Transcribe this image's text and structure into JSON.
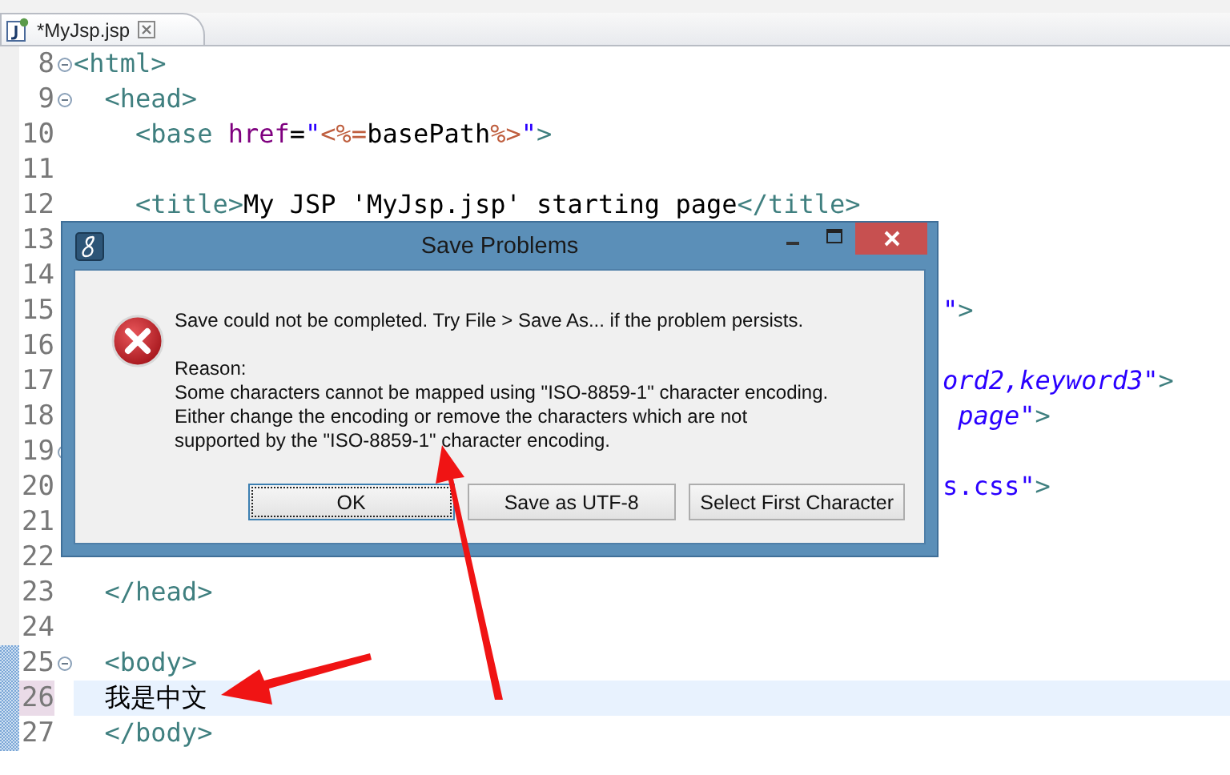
{
  "tabs": [
    {
      "label": "*MyJsp.jsp",
      "selected": true
    }
  ],
  "editor": {
    "lines": [
      {
        "number": "8",
        "fold": true,
        "changed": false,
        "current": false,
        "segments": [
          {
            "kind": "tag",
            "text": "<html>"
          }
        ]
      },
      {
        "number": "9",
        "fold": true,
        "changed": false,
        "current": false,
        "segments": [
          {
            "kind": "tag",
            "text": "  <head>"
          }
        ]
      },
      {
        "number": "10",
        "fold": false,
        "changed": false,
        "current": false,
        "segments": [
          {
            "kind": "tag",
            "text": "    <base"
          },
          {
            "kind": "attr",
            "text": " href"
          },
          {
            "kind": "text",
            "text": "="
          },
          {
            "kind": "string",
            "text": "\""
          },
          {
            "kind": "jsp",
            "text": "<%="
          },
          {
            "kind": "text",
            "text": "basePath"
          },
          {
            "kind": "jsp",
            "text": "%>"
          },
          {
            "kind": "string",
            "text": "\""
          },
          {
            "kind": "tag",
            "text": ">"
          }
        ]
      },
      {
        "number": "11",
        "fold": false,
        "changed": false,
        "current": false
      },
      {
        "number": "12",
        "fold": false,
        "changed": false,
        "current": false,
        "segments": [
          {
            "kind": "tag",
            "text": "    <title>"
          },
          {
            "kind": "text",
            "text": "My JSP 'MyJsp.jsp' starting page"
          },
          {
            "kind": "tag",
            "text": "</title>"
          }
        ]
      },
      {
        "number": "13",
        "fold": false,
        "changed": false,
        "current": false
      },
      {
        "number": "14",
        "fold": false,
        "changed": false,
        "current": false
      },
      {
        "number": "15",
        "fold": false,
        "changed": false,
        "current": false,
        "segments": [
          {
            "kind": "string",
            "text": "\""
          },
          {
            "kind": "tag",
            "text": ">"
          }
        ],
        "behind_dialog": true
      },
      {
        "number": "16",
        "fold": false,
        "changed": false,
        "current": false
      },
      {
        "number": "17",
        "fold": false,
        "changed": false,
        "current": false,
        "segments": [
          {
            "kind": "string-italic",
            "text": "ord2,keyword3\""
          },
          {
            "kind": "tag",
            "text": ">"
          }
        ],
        "behind_dialog": true
      },
      {
        "number": "18",
        "fold": false,
        "changed": false,
        "current": false,
        "segments": [
          {
            "kind": "string-italic",
            "text": " page\""
          },
          {
            "kind": "tag",
            "text": ">"
          }
        ],
        "behind_dialog": true
      },
      {
        "number": "19",
        "fold": true,
        "changed": false,
        "current": false
      },
      {
        "number": "20",
        "fold": false,
        "changed": false,
        "current": false,
        "segments": [
          {
            "kind": "string",
            "text": "s.css\""
          },
          {
            "kind": "tag",
            "text": ">"
          }
        ],
        "behind_dialog": true
      },
      {
        "number": "21",
        "fold": false,
        "changed": false,
        "current": false
      },
      {
        "number": "22",
        "fold": false,
        "changed": false,
        "current": false
      },
      {
        "number": "23",
        "fold": false,
        "changed": false,
        "current": false,
        "segments": [
          {
            "kind": "tag",
            "text": "  </head>"
          }
        ]
      },
      {
        "number": "24",
        "fold": false,
        "changed": false,
        "current": false
      },
      {
        "number": "25",
        "fold": true,
        "changed": true,
        "current": false,
        "segments": [
          {
            "kind": "tag",
            "text": "  <body>"
          }
        ]
      },
      {
        "number": "26",
        "fold": false,
        "changed": true,
        "current": true,
        "segments": [
          {
            "kind": "text",
            "text": "  我是中文"
          }
        ]
      },
      {
        "number": "27",
        "fold": false,
        "changed": true,
        "current": false,
        "segments": [
          {
            "kind": "tag",
            "text": "  </body>"
          }
        ]
      }
    ]
  },
  "dialog": {
    "title": "Save Problems",
    "message": "Save could not be completed. Try File > Save As... if the problem persists.",
    "reason_label": "Reason:",
    "reason": [
      "Some characters cannot be mapped using \"ISO-8859-1\" character encoding.",
      "Either change the encoding or remove the characters which are not",
      "supported by the \"ISO-8859-1\" character encoding."
    ],
    "buttons": [
      {
        "label": "OK",
        "focused": true
      },
      {
        "label": "Save as UTF-8",
        "focused": false
      },
      {
        "label": "Select First Character",
        "focused": false
      }
    ]
  }
}
